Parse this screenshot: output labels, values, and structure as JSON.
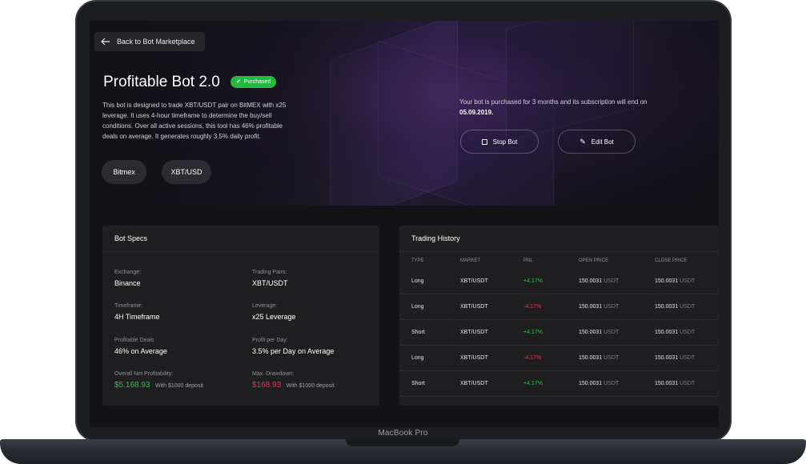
{
  "back_button": {
    "label": "Back to Bot Marketplace"
  },
  "bot": {
    "title": "Profitable Bot 2.0",
    "status": "Purchased",
    "description": "This bot is designed to trade XBT/USDT pair on BitMEX with x25 leverage. It uses 4-hour timeframe to determine the buy/sell conditions. Over all active sessions, this tool has 46% profitable deals on average. It generates roughly 3.5% daily profit.",
    "tags": [
      "Bitmex",
      "XBT/USD"
    ]
  },
  "subscription": {
    "note": "Your bot is purchased for 3 months and its subscription will end on",
    "end_date": "05.09.2019."
  },
  "actions": {
    "stop": "Stop Bot",
    "edit": "Edit Bot"
  },
  "specs": {
    "title": "Bot Specs",
    "exchange": {
      "label": "Exchange:",
      "value": "Binance"
    },
    "pairs": {
      "label": "Trading Pairs:",
      "value": "XBT/USDT"
    },
    "timeframe": {
      "label": "Timeframe:",
      "value": "4H Timeframe"
    },
    "leverage": {
      "label": "Leverage:",
      "value": "x25 Leverage"
    },
    "deals": {
      "label": "Profitable Deals",
      "value": "46% on Average"
    },
    "profit_day": {
      "label": "Profit per Day:",
      "value": "3.5% per Day on Average"
    },
    "net": {
      "label": "Overall Net Profitability:",
      "value": "$5.168.93",
      "note": "With $1000 deposit"
    },
    "drawdown": {
      "label": "Max. Drawdown:",
      "value": "$168.93",
      "note": "With $1000 deposit"
    }
  },
  "history": {
    "title": "Trading History",
    "columns": [
      "TYPE",
      "MARKET",
      "PNL",
      "OPEN PRICE",
      "CLOSE PRICE"
    ],
    "rows": [
      {
        "type": "Long",
        "market": "XBT/USDT",
        "pnl": "+4.17%",
        "open": "150.0031",
        "open_unit": "USDT",
        "close": "150.0031",
        "close_unit": "USDT"
      },
      {
        "type": "Long",
        "market": "XBT/USDT",
        "pnl": "-4.17%",
        "open": "150.0031",
        "open_unit": "USDT",
        "close": "150.0031",
        "close_unit": "USDT"
      },
      {
        "type": "Short",
        "market": "XBT/USDT",
        "pnl": "+4.17%",
        "open": "150.0031",
        "open_unit": "USDT",
        "close": "150.0031",
        "close_unit": "USDT"
      },
      {
        "type": "Long",
        "market": "XBT/USDT",
        "pnl": "-4.17%",
        "open": "150.0031",
        "open_unit": "USDT",
        "close": "150.0031",
        "close_unit": "USDT"
      },
      {
        "type": "Short",
        "market": "XBT/USDT",
        "pnl": "+4.17%",
        "open": "150.0031",
        "open_unit": "USDT",
        "close": "150.0031",
        "close_unit": "USDT"
      }
    ]
  },
  "device": {
    "brand": "MacBook Pro"
  },
  "colors": {
    "accent_green": "#25b93f",
    "negative_red": "#e5304a",
    "background": "#141416",
    "panel": "#1f1f22"
  }
}
